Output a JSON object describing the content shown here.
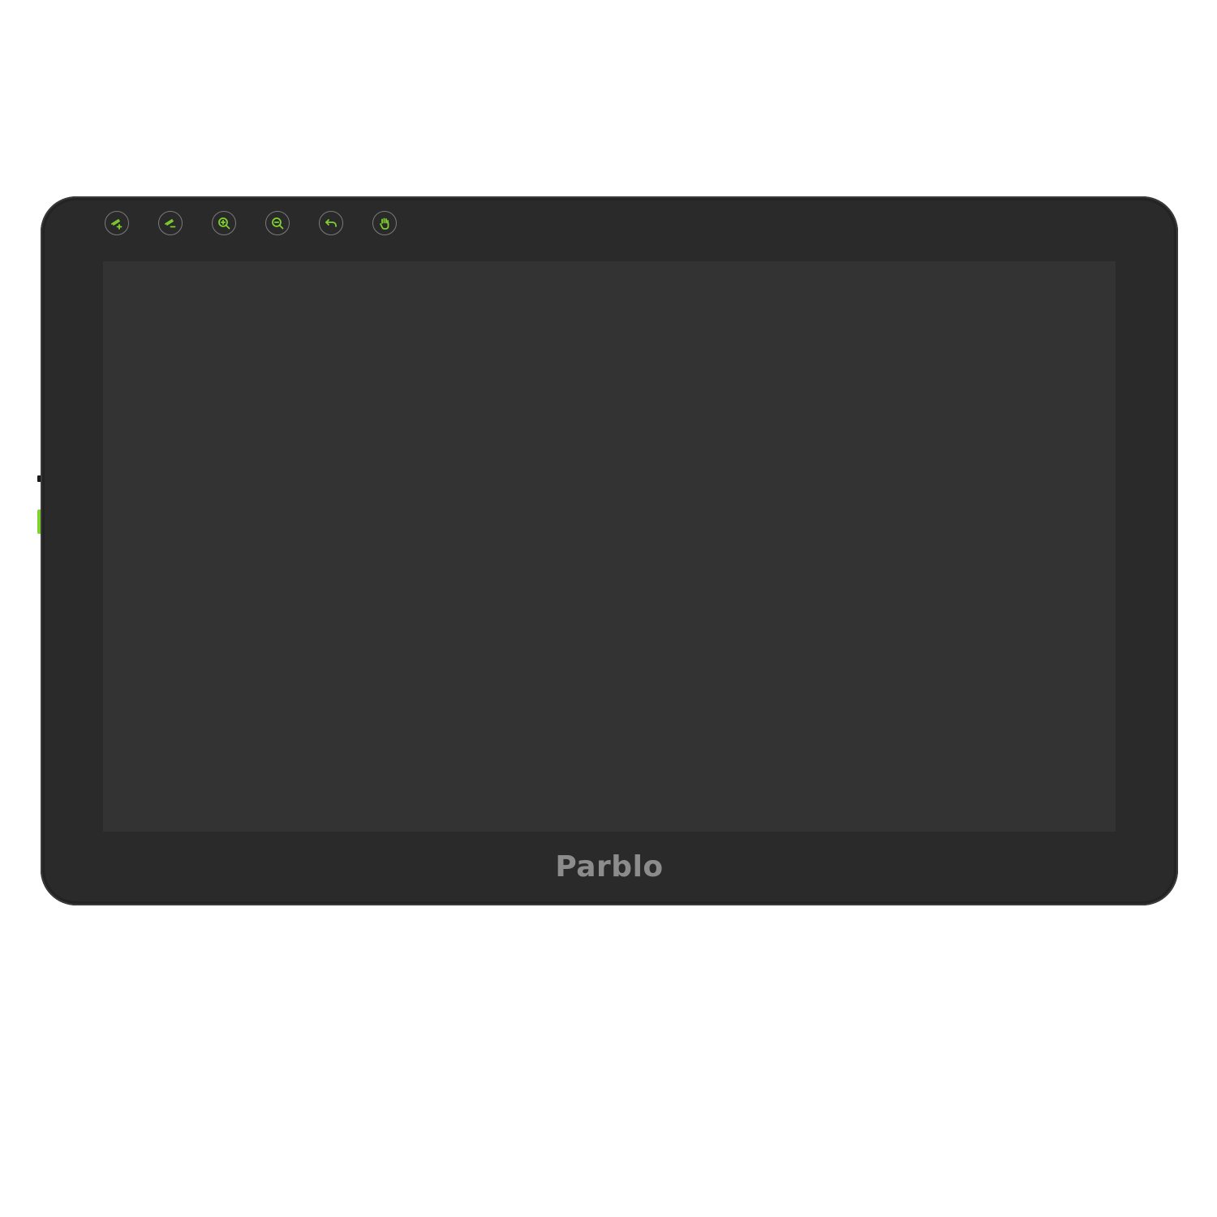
{
  "device": {
    "brand": "Parblo",
    "accent_color": "#7fd12e",
    "bezel_color": "#2a2a2a",
    "screen_color": "#333333"
  },
  "express_keys": [
    {
      "icon": "brush-size-up-icon"
    },
    {
      "icon": "brush-size-down-icon"
    },
    {
      "icon": "zoom-in-icon"
    },
    {
      "icon": "zoom-out-icon"
    },
    {
      "icon": "undo-icon"
    },
    {
      "icon": "hand-icon"
    }
  ]
}
